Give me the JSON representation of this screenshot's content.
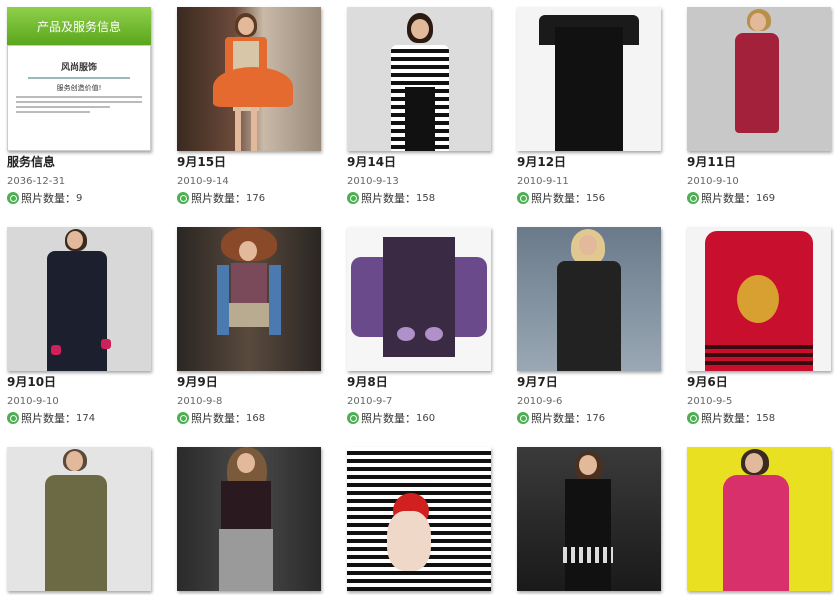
{
  "service_card": {
    "banner": "产品及服务信息",
    "heading": "风尚服饰",
    "slogan": "服务创造价值!",
    "title": "服务信息",
    "date": "2036-12-31",
    "count_label": "照片数量：",
    "count": "9"
  },
  "albums": [
    {
      "title": "9月15日",
      "date": "2010-9-14",
      "count": "176"
    },
    {
      "title": "9月14日",
      "date": "2010-9-13",
      "count": "158"
    },
    {
      "title": "9月12日",
      "date": "2010-9-11",
      "count": "156"
    },
    {
      "title": "9月11日",
      "date": "2010-9-10",
      "count": "169"
    },
    {
      "title": "9月10日",
      "date": "2010-9-10",
      "count": "174"
    },
    {
      "title": "9月9日",
      "date": "2010-9-8",
      "count": "168"
    },
    {
      "title": "9月8日",
      "date": "2010-9-7",
      "count": "160"
    },
    {
      "title": "9月7日",
      "date": "2010-9-6",
      "count": "176"
    },
    {
      "title": "9月6日",
      "date": "2010-9-5",
      "count": "158"
    }
  ],
  "count_label": "照片数量：",
  "colors": {
    "banner_green": "#6cbb2a",
    "count_icon": "#4caf50"
  }
}
